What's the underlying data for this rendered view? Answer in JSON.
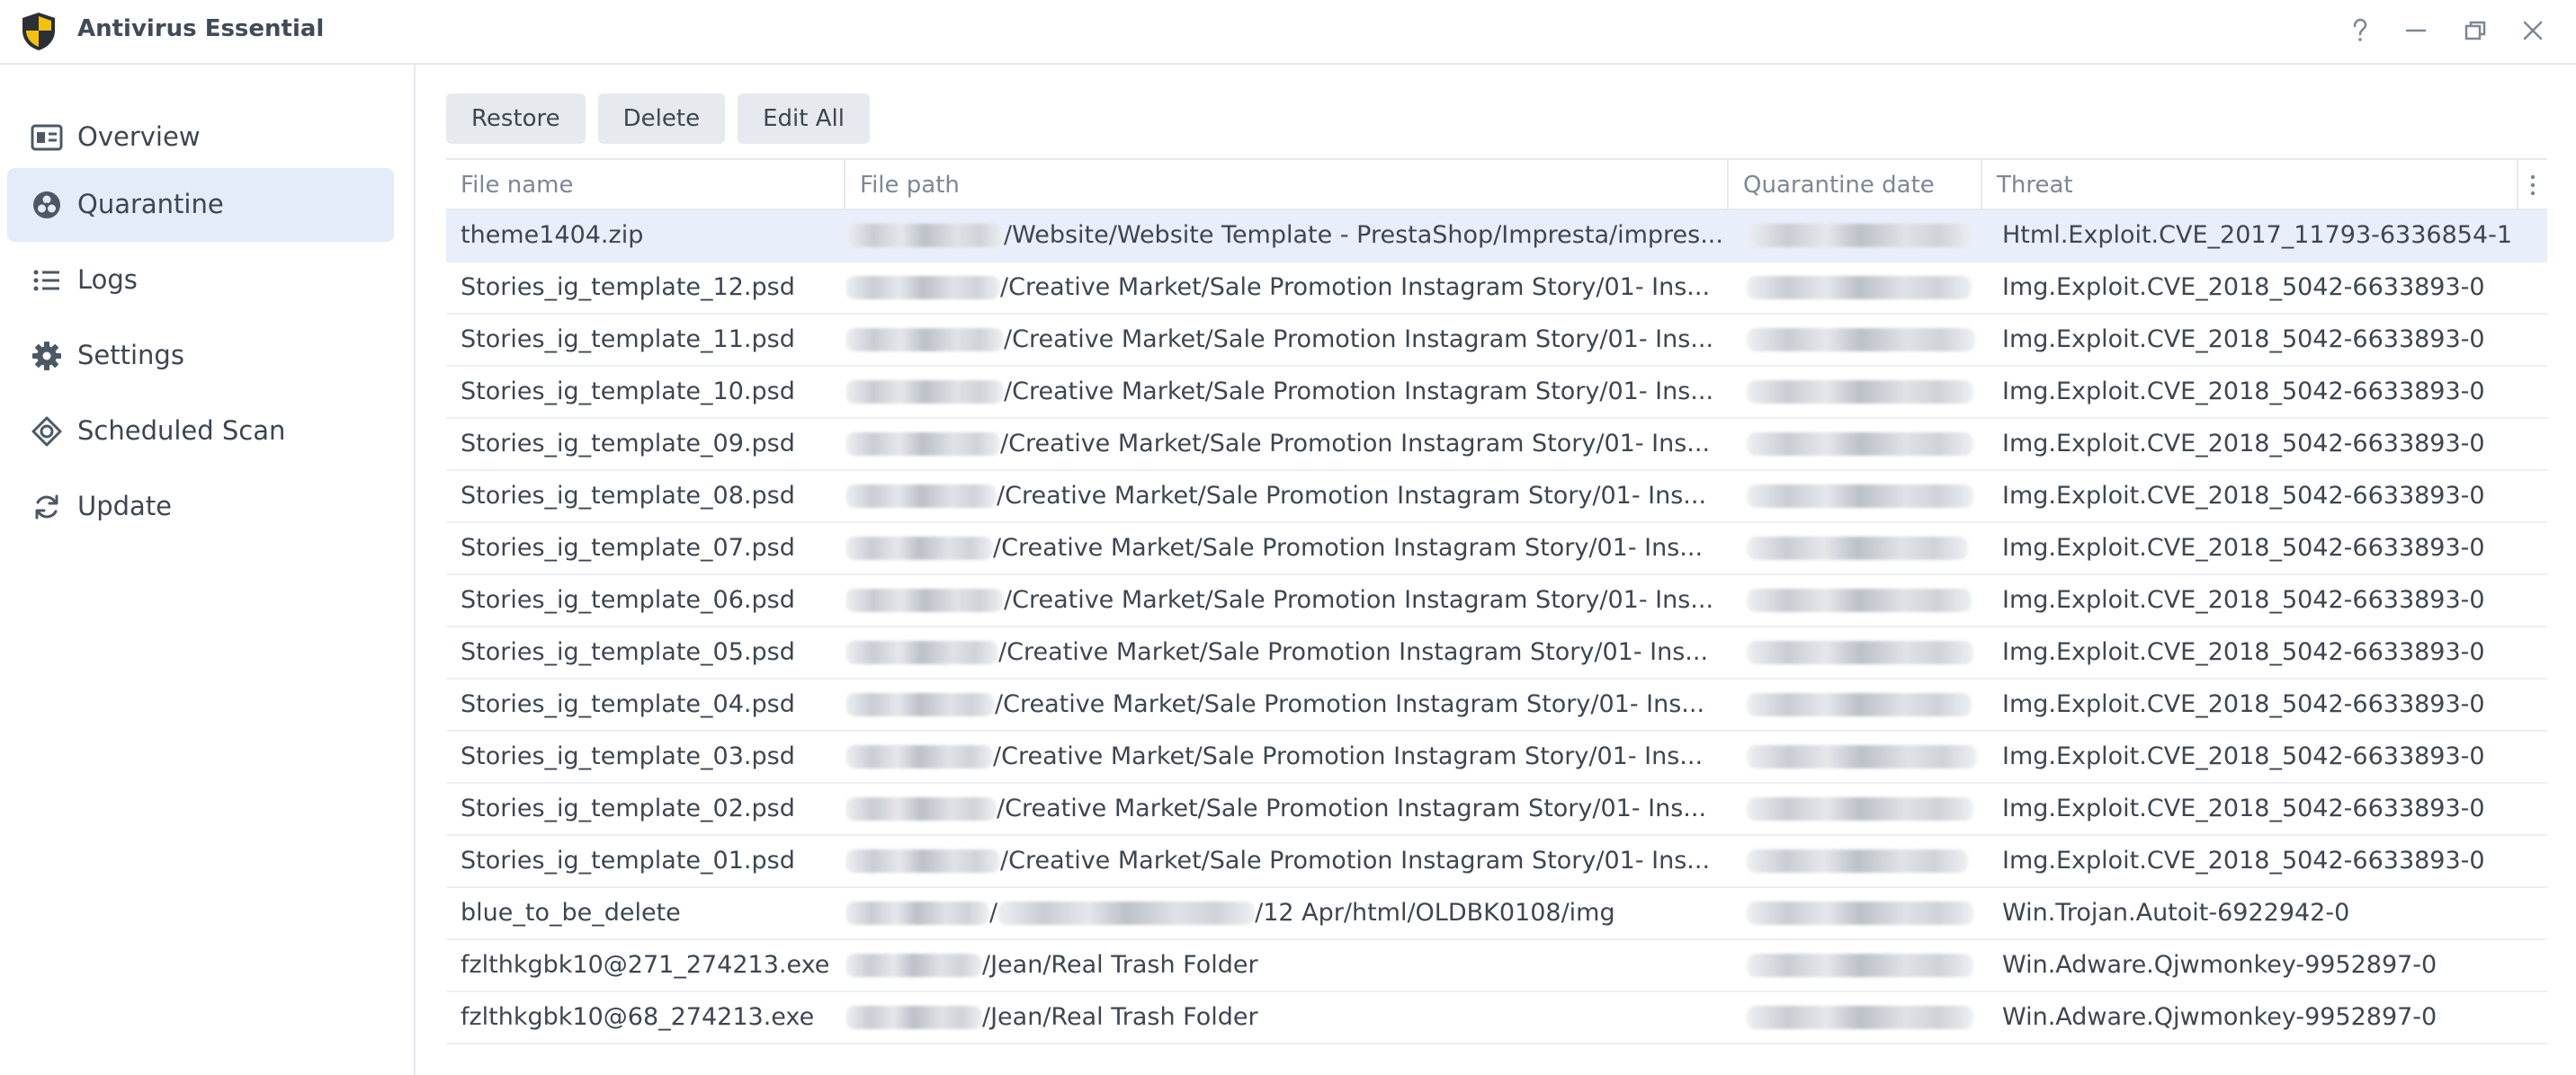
{
  "app": {
    "title": "Antivirus Essential"
  },
  "window_controls": {
    "help": "help-icon",
    "minimize": "minimize-icon",
    "restore": "restore-icon",
    "close": "close-icon"
  },
  "colors": {
    "accent_selected": "#e3ecf8",
    "row_selected": "#e8effa",
    "logo_yellow": "#f4c20d",
    "logo_dark": "#2b2f36"
  },
  "sidebar": {
    "items": [
      {
        "label": "Overview",
        "icon": "overview-icon",
        "active": false
      },
      {
        "label": "Quarantine",
        "icon": "biohazard-icon",
        "active": true
      },
      {
        "label": "Logs",
        "icon": "list-icon",
        "active": false
      },
      {
        "label": "Settings",
        "icon": "gear-icon",
        "active": false
      },
      {
        "label": "Scheduled Scan",
        "icon": "target-icon",
        "active": false
      },
      {
        "label": "Update",
        "icon": "refresh-icon",
        "active": false
      }
    ]
  },
  "toolbar": {
    "restore_label": "Restore",
    "delete_label": "Delete",
    "edit_all_label": "Edit All"
  },
  "table": {
    "columns": {
      "file_name": "File name",
      "file_path": "File path",
      "quarantine_date": "Quarantine date",
      "threat": "Threat"
    },
    "rows": [
      {
        "file_name": "theme1404.zip",
        "file_path": "/Website/Website Template - PrestaShop/Impresta/impres...",
        "threat": "Html.Exploit.CVE_2017_11793-6336854-1",
        "selected": true
      },
      {
        "file_name": "Stories_ig_template_12.psd",
        "file_path": "/Creative Market/Sale Promotion Instagram Story/01- Ins...",
        "threat": "Img.Exploit.CVE_2018_5042-6633893-0"
      },
      {
        "file_name": "Stories_ig_template_11.psd",
        "file_path": "/Creative Market/Sale Promotion Instagram Story/01- Ins...",
        "threat": "Img.Exploit.CVE_2018_5042-6633893-0"
      },
      {
        "file_name": "Stories_ig_template_10.psd",
        "file_path": "/Creative Market/Sale Promotion Instagram Story/01- Ins...",
        "threat": "Img.Exploit.CVE_2018_5042-6633893-0"
      },
      {
        "file_name": "Stories_ig_template_09.psd",
        "file_path": "/Creative Market/Sale Promotion Instagram Story/01- Ins...",
        "threat": "Img.Exploit.CVE_2018_5042-6633893-0"
      },
      {
        "file_name": "Stories_ig_template_08.psd",
        "file_path": "/Creative Market/Sale Promotion Instagram Story/01- Ins...",
        "threat": "Img.Exploit.CVE_2018_5042-6633893-0"
      },
      {
        "file_name": "Stories_ig_template_07.psd",
        "file_path": "/Creative Market/Sale Promotion Instagram Story/01- Ins...",
        "threat": "Img.Exploit.CVE_2018_5042-6633893-0"
      },
      {
        "file_name": "Stories_ig_template_06.psd",
        "file_path": "/Creative Market/Sale Promotion Instagram Story/01- Ins...",
        "threat": "Img.Exploit.CVE_2018_5042-6633893-0"
      },
      {
        "file_name": "Stories_ig_template_05.psd",
        "file_path": "/Creative Market/Sale Promotion Instagram Story/01- Ins...",
        "threat": "Img.Exploit.CVE_2018_5042-6633893-0"
      },
      {
        "file_name": "Stories_ig_template_04.psd",
        "file_path": "/Creative Market/Sale Promotion Instagram Story/01- Ins...",
        "threat": "Img.Exploit.CVE_2018_5042-6633893-0"
      },
      {
        "file_name": "Stories_ig_template_03.psd",
        "file_path": "/Creative Market/Sale Promotion Instagram Story/01- Ins...",
        "threat": "Img.Exploit.CVE_2018_5042-6633893-0"
      },
      {
        "file_name": "Stories_ig_template_02.psd",
        "file_path": "/Creative Market/Sale Promotion Instagram Story/01- Ins...",
        "threat": "Img.Exploit.CVE_2018_5042-6633893-0"
      },
      {
        "file_name": "Stories_ig_template_01.psd",
        "file_path": "/Creative Market/Sale Promotion Instagram Story/01- Ins...",
        "threat": "Img.Exploit.CVE_2018_5042-6633893-0"
      },
      {
        "file_name": "blue_to_be_delete",
        "file_path_prefix": "/",
        "file_path": "/12 Apr/html/OLDBK0108/img",
        "threat": "Win.Trojan.Autoit-6922942-0"
      },
      {
        "file_name": "fzlthkgbk10@271_274213.exe",
        "file_path": "/Jean/Real Trash Folder",
        "threat": "Win.Adware.Qjwmonkey-9952897-0"
      },
      {
        "file_name": "fzlthkgbk10@68_274213.exe",
        "file_path": "/Jean/Real Trash Folder",
        "threat": "Win.Adware.Qjwmonkey-9952897-0"
      }
    ]
  }
}
